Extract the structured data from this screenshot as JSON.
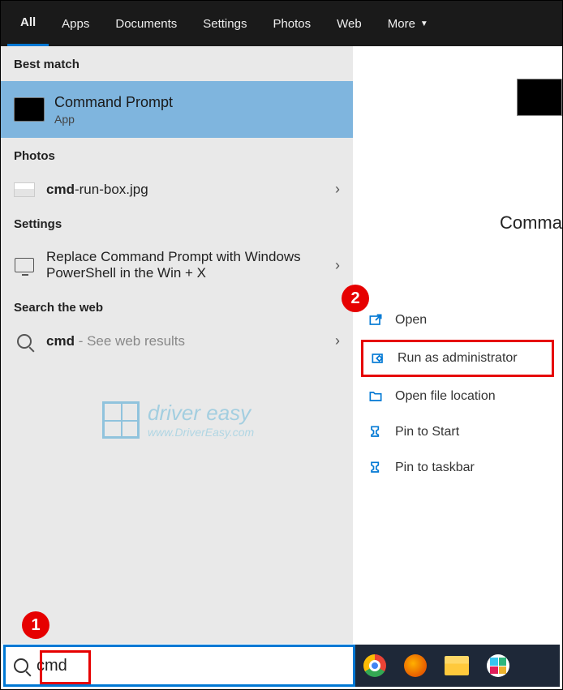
{
  "tabs": {
    "all": "All",
    "apps": "Apps",
    "documents": "Documents",
    "settings": "Settings",
    "photos": "Photos",
    "web": "Web",
    "more": "More"
  },
  "sections": {
    "best_match": "Best match",
    "photos": "Photos",
    "settings": "Settings",
    "search_web": "Search the web"
  },
  "best_match": {
    "title": "Command Prompt",
    "subtitle": "App"
  },
  "photos_row": {
    "bold": "cmd",
    "rest": "-run-box.jpg"
  },
  "settings_row": {
    "text": "Replace Command Prompt with Windows PowerShell in the Win + X"
  },
  "web_row": {
    "bold": "cmd",
    "rest": " - See web results"
  },
  "right_panel": {
    "title": "Comma"
  },
  "actions": {
    "open": "Open",
    "run_admin": "Run as administrator",
    "open_loc": "Open file location",
    "pin_start": "Pin to Start",
    "pin_taskbar": "Pin to taskbar"
  },
  "search": {
    "value": "cmd"
  },
  "badges": {
    "one": "1",
    "two": "2"
  },
  "watermark": {
    "line1": "driver easy",
    "line2": "www.DriverEasy.com"
  }
}
